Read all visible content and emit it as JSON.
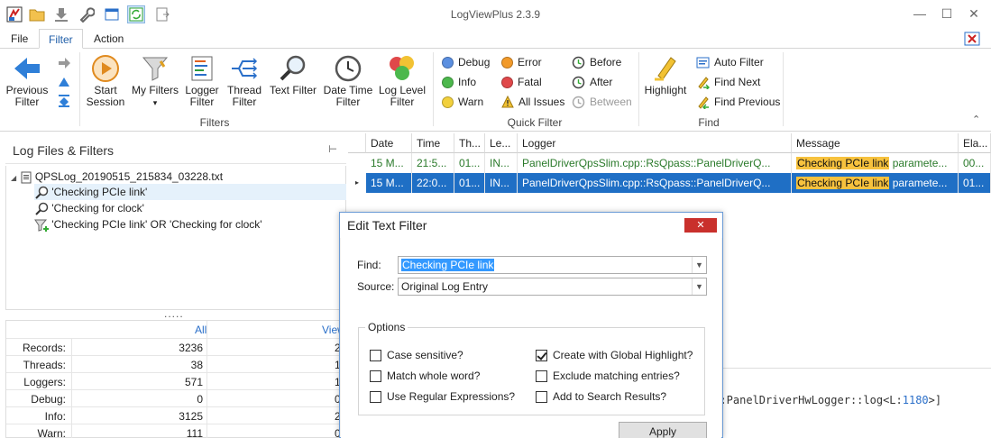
{
  "app": {
    "title": "LogViewPlus 2.3.9"
  },
  "menu": {
    "tabs": [
      {
        "label": "File"
      },
      {
        "label": "Filter"
      },
      {
        "label": "Action"
      }
    ]
  },
  "ribbon": {
    "filters": {
      "group_label": "Filters",
      "previous": "Previous\nFilter",
      "start_session": "Start\nSession",
      "my_filters": "My Filters",
      "logger_filter": "Logger\nFilter",
      "thread_filter": "Thread\nFilter",
      "text_filter": "Text Filter",
      "datetime_filter": "Date Time\nFilter",
      "loglevel_filter": "Log Level\nFilter"
    },
    "quick_filter": {
      "group_label": "Quick Filter",
      "debug": "Debug",
      "info": "Info",
      "warn": "Warn",
      "error": "Error",
      "fatal": "Fatal",
      "all_issues": "All Issues",
      "before": "Before",
      "after": "After",
      "between": "Between"
    },
    "find": {
      "group_label": "Find",
      "highlight": "Highlight",
      "auto_filter": "Auto Filter",
      "find_next": "Find Next",
      "find_previous": "Find Previous"
    }
  },
  "left": {
    "title": "Log Files & Filters",
    "file": "QPSLog_20190515_215834_03228.txt",
    "filters": [
      "'Checking PCIe link'",
      "'Checking for clock'",
      "'Checking PCIe link' OR 'Checking for clock'"
    ],
    "dots": "....."
  },
  "stats": {
    "col_all": "All",
    "col_view": "View",
    "rows": [
      {
        "label": "Records:",
        "all": "3236",
        "view": "2"
      },
      {
        "label": "Threads:",
        "all": "38",
        "view": "1"
      },
      {
        "label": "Loggers:",
        "all": "571",
        "view": "1"
      },
      {
        "label": "Debug:",
        "all": "0",
        "view": "0"
      },
      {
        "label": "Info:",
        "all": "3125",
        "view": "2"
      },
      {
        "label": "Warn:",
        "all": "111",
        "view": "0"
      }
    ]
  },
  "grid": {
    "columns": [
      "Date",
      "Time",
      "Th...",
      "Le...",
      "Logger",
      "Message",
      "Ela..."
    ],
    "rows": [
      {
        "date": "15 M...",
        "time": "21:5...",
        "thread": "01...",
        "level": "IN...",
        "logger": "PanelDriverQpsSlim.cpp::RsQpass::PanelDriverQ...",
        "hl": "Checking PCIe link",
        "msg": " paramete...",
        "elapsed": "00..."
      },
      {
        "date": "15 M...",
        "time": "22:0...",
        "thread": "01...",
        "level": "IN...",
        "logger": "PanelDriverQpsSlim.cpp::RsQpass::PanelDriverQ...",
        "hl": "Checking PCIe link",
        "msg": " paramete...",
        "elapsed": "01..."
      }
    ]
  },
  "detail": {
    "code_prefix": "n::PanelDriverHwLogger::log<L:",
    "code_num": "1180",
    "code_suffix": ">]"
  },
  "dialog": {
    "title": "Edit Text Filter",
    "close": "✕",
    "find_label": "Find:",
    "find_value": "Checking PCIe link",
    "source_label": "Source:",
    "source_value": "Original Log Entry",
    "options_label": "Options",
    "case_sensitive": "Case sensitive?",
    "match_whole": "Match whole word?",
    "use_regex": "Use Regular Expressions?",
    "global_highlight": "Create with Global Highlight?",
    "exclude": "Exclude matching entries?",
    "add_search": "Add to Search Results?",
    "apply": "Apply"
  }
}
